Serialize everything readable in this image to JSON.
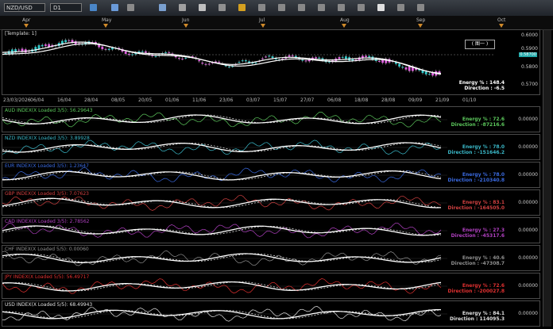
{
  "toolbar": {
    "symbol": "NZD/USD",
    "timeframe": "D1"
  },
  "timeline": {
    "months": [
      "Apr",
      "May",
      "Jun",
      "Jul",
      "Aug",
      "Sep",
      "Oct"
    ]
  },
  "main_panel": {
    "template_label": "[Template: 1]",
    "legend_label": "( 图一 )",
    "price_ticks": [
      "0.6000",
      "0.5900",
      "0.5800",
      "0.5700"
    ],
    "current_price": "0.58700",
    "energy_text": "Energy % : 148.4",
    "direction_text": "Direction : -6.5",
    "dates": [
      "23/03/2026",
      "06/04",
      "16/04",
      "28/04",
      "08/05",
      "20/05",
      "01/06",
      "11/06",
      "23/06",
      "03/07",
      "15/07",
      "27/07",
      "06/08",
      "18/08",
      "28/08",
      "09/09",
      "21/09",
      "01/10"
    ]
  },
  "indicators": [
    {
      "label": "AUD INDEX(X Loaded 3/5): 56.29643",
      "color": "#5cc85c",
      "energy": "Energy % : 72.6",
      "direction": "Direction : -87216.6",
      "tick": "0.00000"
    },
    {
      "label": "NZD INDEX(X Loaded 3/5): 3.89928",
      "color": "#3ab8c8",
      "energy": "Energy % : 78.0",
      "direction": "Direction : -151646.2",
      "tick": "0.00000"
    },
    {
      "label": "EUR INDEX(X Loaded 3/5): 1.23647",
      "color": "#3a6ae0",
      "energy": "Energy % : 78.0",
      "direction": "Direction : -210340.8",
      "tick": "0.00000"
    },
    {
      "label": "GBP INDEX(X Loaded 3/5): 7.07623",
      "color": "#d04040",
      "energy": "Energy % : 83.1",
      "direction": "Direction : -164505.0",
      "tick": "0.00000"
    },
    {
      "label": "CAD INDEX(X Loaded 3/5): 2.78562",
      "color": "#b040c0",
      "energy": "Energy % : 27.3",
      "direction": "Direction : -45317.6",
      "tick": "0.00000"
    },
    {
      "label": "CHF INDEX(X Loaded 5/5): 0.00060",
      "color": "#909090",
      "energy": "Energy % : 40.6",
      "direction": "Direction : -47308.7",
      "tick": "0.00000"
    },
    {
      "label": "JPY INDEX(X Loaded 5/5): 56.49717",
      "color": "#e03030",
      "energy": "Energy % : 72.6",
      "direction": "Direction : -200027.8",
      "tick": "0.00000"
    },
    {
      "label": "USD INDEX(X Loaded 5/5): 68.49943",
      "color": "#e0e0e0",
      "energy": "Energy % : 84.1",
      "direction": "Direction : 114095.3",
      "tick": "0.00000"
    }
  ]
}
